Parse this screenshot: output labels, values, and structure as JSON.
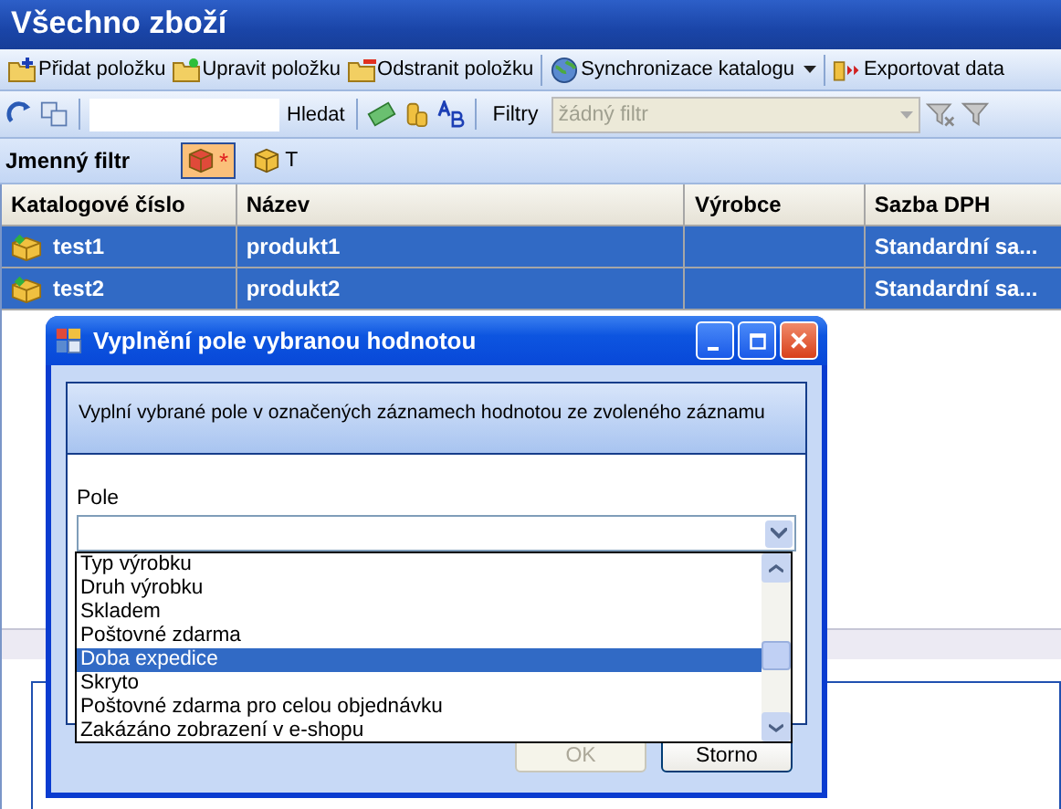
{
  "window": {
    "title": "Všechno zboží"
  },
  "toolbar": [
    {
      "label": "Přidat položku",
      "kind": "add",
      "dropdown": false
    },
    {
      "label": "Upravit položku",
      "kind": "edit",
      "dropdown": false
    },
    {
      "label": "Odstranit položku",
      "kind": "remove",
      "dropdown": false
    },
    {
      "label": "Synchronizace katalogu",
      "kind": "sync",
      "dropdown": true
    },
    {
      "label": "Exportovat data",
      "kind": "export",
      "dropdown": false
    }
  ],
  "search": {
    "button": "Hledat"
  },
  "filters": {
    "label": "Filtry",
    "placeholder": "žádný filtr",
    "disabled": true
  },
  "name_filter": {
    "label": "Jmenný filtr",
    "options": [
      {
        "label": "*",
        "selected": true
      },
      {
        "label": "T",
        "selected": false
      }
    ]
  },
  "table": {
    "columns": [
      "Katalogové číslo",
      "Název",
      "Výrobce",
      "Sazba DPH"
    ],
    "rows": [
      {
        "cells": [
          "test1",
          "produkt1",
          "",
          "Standardní sa..."
        ],
        "selected": true
      },
      {
        "cells": [
          "test2",
          "produkt2",
          "",
          "Standardní sa..."
        ],
        "selected": true
      }
    ]
  },
  "dialog": {
    "title": "Vyplnění pole vybranou hodnotou",
    "description": "Vyplní vybrané pole v označených záznamech hodnotou ze zvoleného záznamu",
    "field_label": "Pole",
    "list": [
      {
        "label": "Typ výrobku",
        "selected": false
      },
      {
        "label": "Druh výrobku",
        "selected": false
      },
      {
        "label": "Skladem",
        "selected": false
      },
      {
        "label": "Poštovné zdarma",
        "selected": false
      },
      {
        "label": "Doba expedice",
        "selected": true
      },
      {
        "label": "Skryto",
        "selected": false
      },
      {
        "label": "Poštovné zdarma pro celou objednávku",
        "selected": false
      },
      {
        "label": "Zakázáno zobrazení v e-shopu",
        "selected": false
      }
    ],
    "buttons": [
      {
        "label": "OK",
        "disabled": true
      },
      {
        "label": "Storno",
        "disabled": false
      }
    ]
  }
}
